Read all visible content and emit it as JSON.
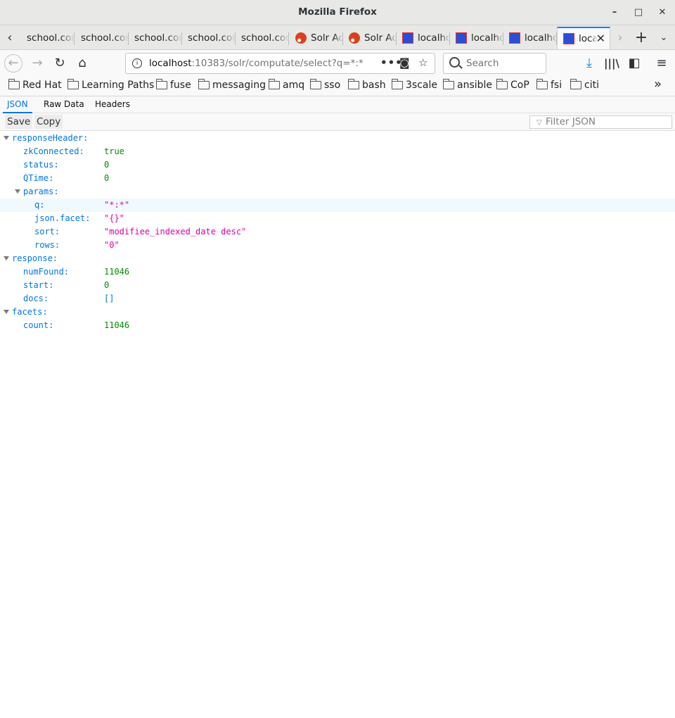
{
  "window": {
    "title": "Mozilla Firefox",
    "controls": [
      "minimize",
      "maximize",
      "close"
    ]
  },
  "tabs": [
    {
      "label": "school.com",
      "icon": "none"
    },
    {
      "label": "school.com",
      "icon": "none"
    },
    {
      "label": "school.com",
      "icon": "none"
    },
    {
      "label": "school.com",
      "icon": "none"
    },
    {
      "label": "school.com",
      "icon": "none"
    },
    {
      "label": "Solr Admin",
      "icon": "solr-icon"
    },
    {
      "label": "Solr Admin",
      "icon": "solr-icon"
    },
    {
      "label": "localhost",
      "icon": "json-icon"
    },
    {
      "label": "localhost",
      "icon": "json-icon"
    },
    {
      "label": "localhost",
      "icon": "json-icon"
    },
    {
      "label": "localhost",
      "icon": "json-icon",
      "active": true
    }
  ],
  "navbar": {
    "url_host": "localhost",
    "url_rest": ":10383/solr/computate/select?q=*:*",
    "search_placeholder": "Search"
  },
  "bookmarks": [
    "Red Hat",
    "Learning Paths",
    "fuse",
    "messaging",
    "amq",
    "sso",
    "bash",
    "3scale",
    "ansible",
    "CoP",
    "fsi",
    "citi"
  ],
  "json_viewer": {
    "tabs": [
      "JSON",
      "Raw Data",
      "Headers"
    ],
    "active_tab": "JSON",
    "toolbar": {
      "save": "Save",
      "copy": "Copy",
      "filter_placeholder": "Filter JSON"
    }
  },
  "tree": [
    {
      "key": "responseHeader:",
      "level": 0,
      "expanded": true
    },
    {
      "key": "zkConnected:",
      "value": "true",
      "type": "bool",
      "level": 1
    },
    {
      "key": "status:",
      "value": "0",
      "type": "num",
      "level": 1
    },
    {
      "key": "QTime:",
      "value": "0",
      "type": "num",
      "level": 1
    },
    {
      "key": "params:",
      "level": 1,
      "expanded": true
    },
    {
      "key": "q:",
      "value": "\"*:*\"",
      "type": "str",
      "level": 2,
      "highlight": true
    },
    {
      "key": "json.facet:",
      "value": "\"{}\"",
      "type": "str",
      "level": 2
    },
    {
      "key": "sort:",
      "value": "\"modifiee_indexed_date desc\"",
      "type": "str",
      "level": 2
    },
    {
      "key": "rows:",
      "value": "\"0\"",
      "type": "str",
      "level": 2
    },
    {
      "key": "response:",
      "level": 0,
      "expanded": true
    },
    {
      "key": "numFound:",
      "value": "11046",
      "type": "num",
      "level": 1
    },
    {
      "key": "start:",
      "value": "0",
      "type": "num",
      "level": 1
    },
    {
      "key": "docs:",
      "value": "[]",
      "type": "arr",
      "level": 1
    },
    {
      "key": "facets:",
      "level": 0,
      "expanded": true
    },
    {
      "key": "count:",
      "value": "11046",
      "type": "num",
      "level": 1
    }
  ]
}
